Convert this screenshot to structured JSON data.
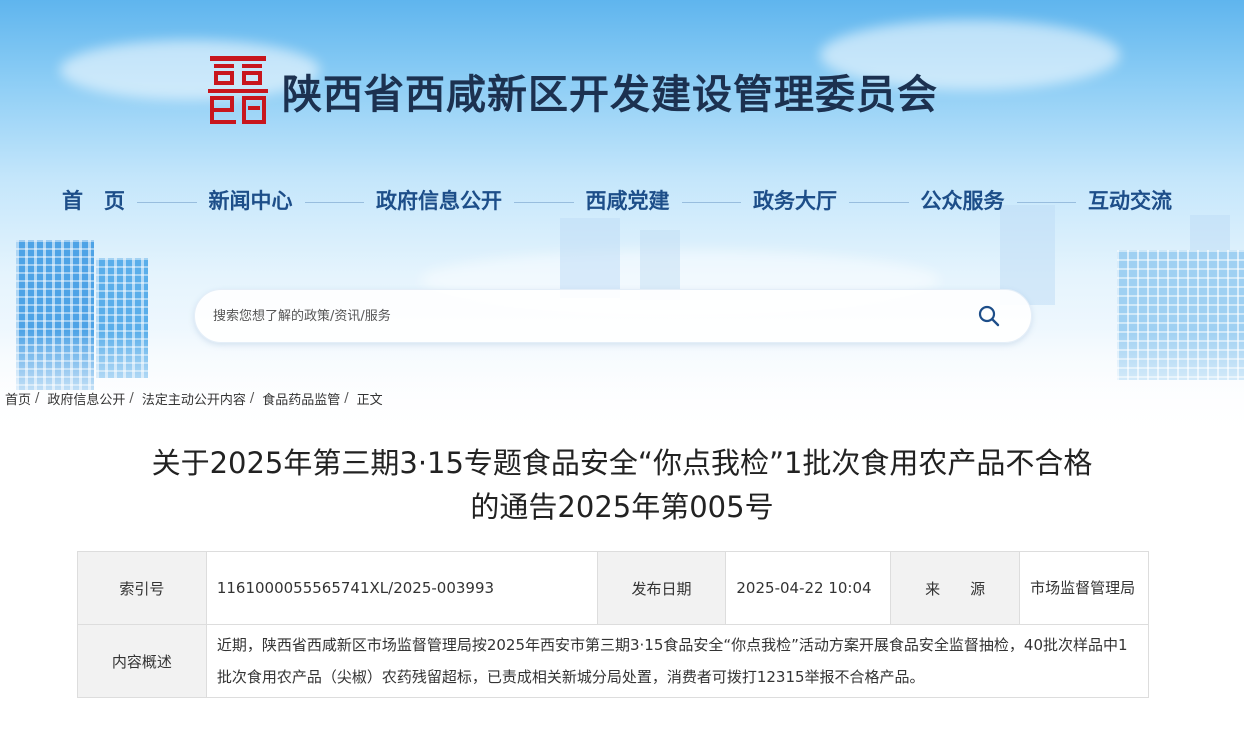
{
  "site": {
    "title": "陕西省西咸新区开发建设管理委员会"
  },
  "nav": {
    "items": [
      "首　页",
      "新闻中心",
      "政府信息公开",
      "西咸党建",
      "政务大厅",
      "公众服务",
      "互动交流"
    ]
  },
  "search": {
    "placeholder": "搜索您想了解的政策/资讯/服务",
    "icon": "search-icon"
  },
  "breadcrumb": {
    "items": [
      "首页",
      "政府信息公开",
      "法定主动公开内容",
      "食品药品监管",
      "正文"
    ]
  },
  "article": {
    "title_line1": "关于2025年第三期3·15专题食品安全“你点我检”1批次食用农产品不合格",
    "title_line2": "的通告2025年第005号"
  },
  "info": {
    "index_label": "索引号",
    "index_value": "1161000055565741XL/2025-003993",
    "date_label": "发布日期",
    "date_value": "2025-04-22 10:04",
    "source_label": "来　　源",
    "source_value": "市场监督管理局",
    "summary_label": "内容概述",
    "summary_value": "近期，陕西省西咸新区市场监督管理局按2025年西安市第三期3·15食品安全“你点我检”活动方案开展食品安全监督抽检，40批次样品中1批次食用农产品（尖椒）农药残留超标，已责成相关新城分局处置，消费者可拨打12315举报不合格产品。"
  },
  "colors": {
    "nav_text": "#1d4e89",
    "title_text": "#1c3150",
    "logo_red": "#c8161d"
  }
}
